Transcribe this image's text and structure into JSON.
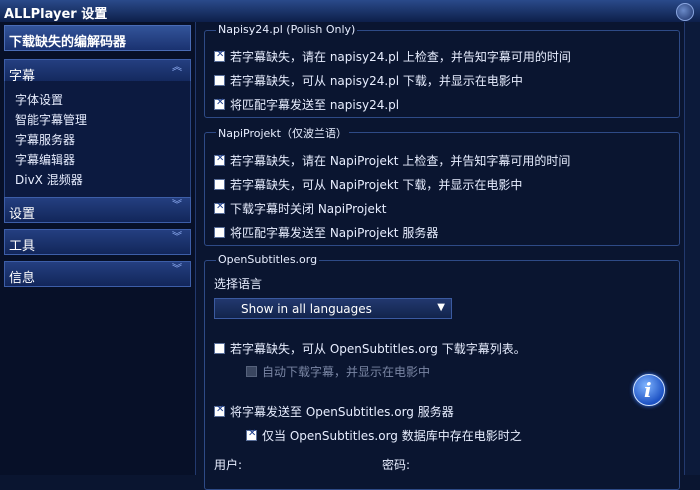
{
  "window": {
    "title": "ALLPlayer 设置"
  },
  "sidebar": {
    "header": "下载缺失的编解码器",
    "sections": [
      {
        "label": "字幕",
        "expanded": true
      },
      {
        "label": "设置",
        "expanded": false
      },
      {
        "label": "工具",
        "expanded": false
      },
      {
        "label": "信息",
        "expanded": false
      }
    ],
    "subtitle_items": [
      "字体设置",
      "智能字幕管理",
      "字幕服务器",
      "字幕编辑器",
      "DivX 混频器"
    ]
  },
  "main": {
    "napisy": {
      "title": "Napisy24.pl (Polish Only)",
      "options": [
        {
          "label": "若字幕缺失，请在 napisy24.pl 上检查，并告知字幕可用的时间",
          "checked": true
        },
        {
          "label": "若字幕缺失，可从 napisy24.pl 下载，并显示在电影中",
          "checked": false
        },
        {
          "label": "将匹配字幕发送至 napisy24.pl",
          "checked": true
        }
      ]
    },
    "napiprojekt": {
      "title": "NapiProjekt（仅波兰语）",
      "options": [
        {
          "label": "若字幕缺失，请在 NapiProjekt 上检查，并告知字幕可用的时间",
          "checked": true
        },
        {
          "label": "若字幕缺失，可从 NapiProjekt 下载，并显示在电影中",
          "checked": false
        },
        {
          "label": "下载字幕时关闭 NapiProjekt",
          "checked": true
        },
        {
          "label": "将匹配字幕发送至 NapiProjekt 服务器",
          "checked": false
        }
      ]
    },
    "opensubtitles": {
      "title": "OpenSubtitles.org",
      "language_label": "选择语言",
      "language_value": "Show in all languages",
      "opt_download": {
        "label": "若字幕缺失，可从 OpenSubtitles.org 下载字幕列表。",
        "checked": false
      },
      "opt_auto": {
        "label": "自动下载字幕，并显示在电影中",
        "checked": false,
        "disabled": true
      },
      "opt_send": {
        "label": "将字幕发送至 OpenSubtitles.org 服务器",
        "checked": true
      },
      "opt_only": {
        "label": "仅当 OpenSubtitles.org 数据库中存在电影时之",
        "checked": true
      },
      "user_label": "用户:",
      "password_label": "密码:"
    }
  },
  "colors": {
    "accent": "#2a4a8a",
    "background": "#0a1530",
    "info": "#1d52c4"
  },
  "icons": {
    "info": "info-icon",
    "chevron_up": "chevron-up-icon",
    "chevron_down": "chevron-down-icon",
    "dropdown": "dropdown-arrow-icon"
  }
}
